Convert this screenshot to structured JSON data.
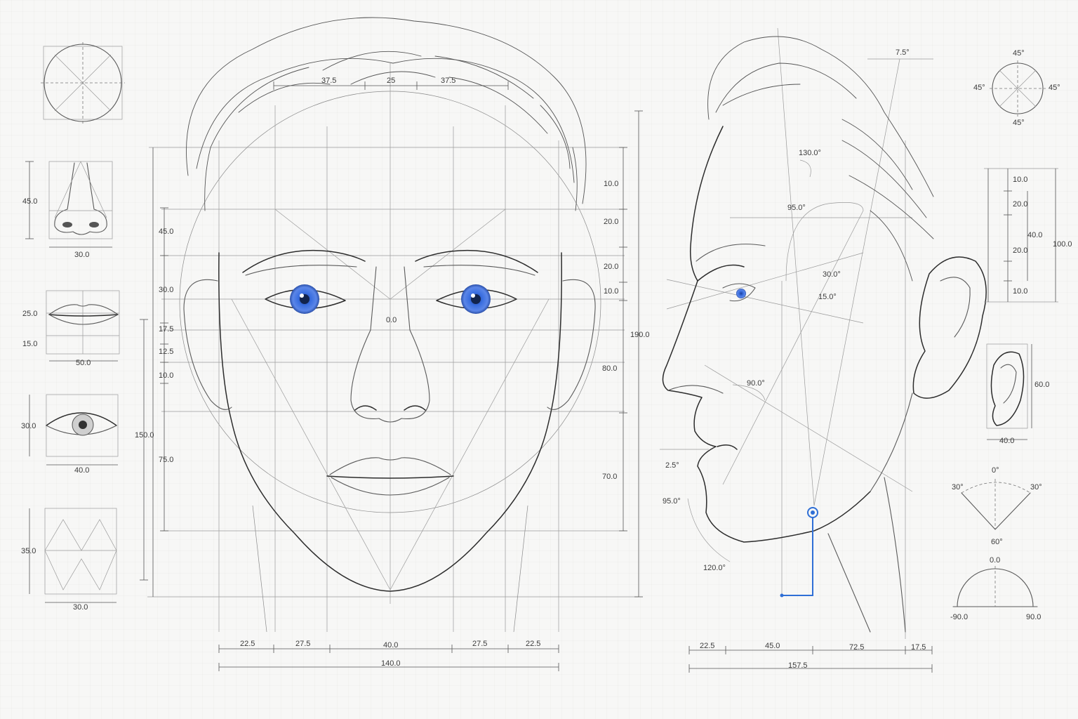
{
  "accent_color": "#2f6fd6",
  "front_view": {
    "top_widths": [
      "37.5",
      "25",
      "37.5"
    ],
    "left_heights": [
      "45.0",
      "30.0",
      "17.5",
      "12.5",
      "10.0",
      "75.0"
    ],
    "left_total": "150.0",
    "right_heights": [
      "10.0",
      "20.0",
      "20.0",
      "10.0",
      "80.0",
      "70.0"
    ],
    "right_total": "190.0",
    "center_mark": "0.0",
    "bottom_widths": [
      "22.5",
      "27.5",
      "40.0",
      "27.5",
      "22.5"
    ],
    "bottom_total": "140.0"
  },
  "profile_view": {
    "angles": [
      "7.5°",
      "130.0°",
      "95.0°",
      "30.0°",
      "15.0°",
      "90.0°",
      "2.5°",
      "95.0°",
      "120.0°"
    ],
    "bottom_widths": [
      "22.5",
      "45.0",
      "72.5",
      "17.5"
    ],
    "bottom_total": "157.5"
  },
  "feature_studies": {
    "nose": {
      "height": "45.0",
      "width": "30.0"
    },
    "lips": {
      "height_top": "25.0",
      "height_bottom": "15.0",
      "width": "50.0"
    },
    "eye": {
      "height": "30.0",
      "width": "40.0"
    },
    "jaw": {
      "height": "35.0",
      "width": "30.0"
    }
  },
  "right_panel": {
    "compass": [
      "45°",
      "45°",
      "45°",
      "45°"
    ],
    "vertical_scale": [
      "10.0",
      "20.0",
      "40.0",
      "20.0",
      "10.0"
    ],
    "vertical_total": "100.0",
    "ear": {
      "height": "60.0",
      "width": "40.0"
    },
    "fan": {
      "top": "0°",
      "left": "30°",
      "right": "30°",
      "bottom": "60°"
    },
    "protractor": {
      "top": "0.0",
      "left": "-90.0",
      "right": "90.0"
    }
  }
}
